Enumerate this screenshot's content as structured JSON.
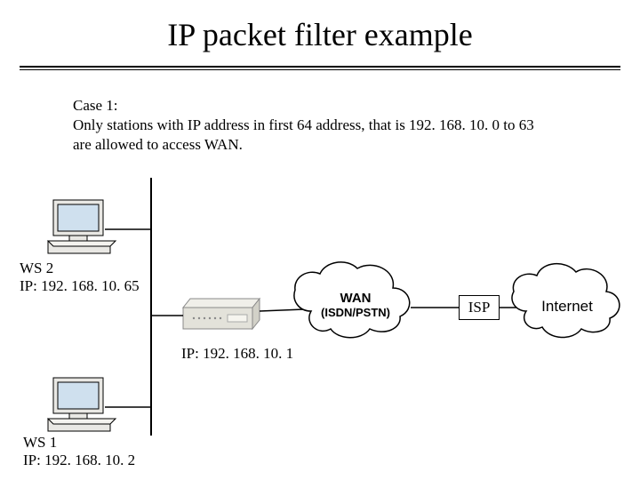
{
  "title": "IP packet filter example",
  "case": {
    "line1": "Case 1:",
    "line2": "Only stations with IP address in first 64 address, that is 192. 168. 10. 0 to 63",
    "line3": " are allowed  to access WAN."
  },
  "ws2": {
    "name": "WS 2",
    "ip": "IP: 192. 168. 10. 65"
  },
  "ws1": {
    "name": "WS 1",
    "ip": "IP: 192. 168. 10. 2"
  },
  "router": {
    "ip": "IP: 192. 168. 10. 1"
  },
  "wan": {
    "line1": "WAN",
    "line2": "(ISDN/PSTN)"
  },
  "isp": {
    "label": "ISP"
  },
  "internet": {
    "label": "Internet"
  }
}
